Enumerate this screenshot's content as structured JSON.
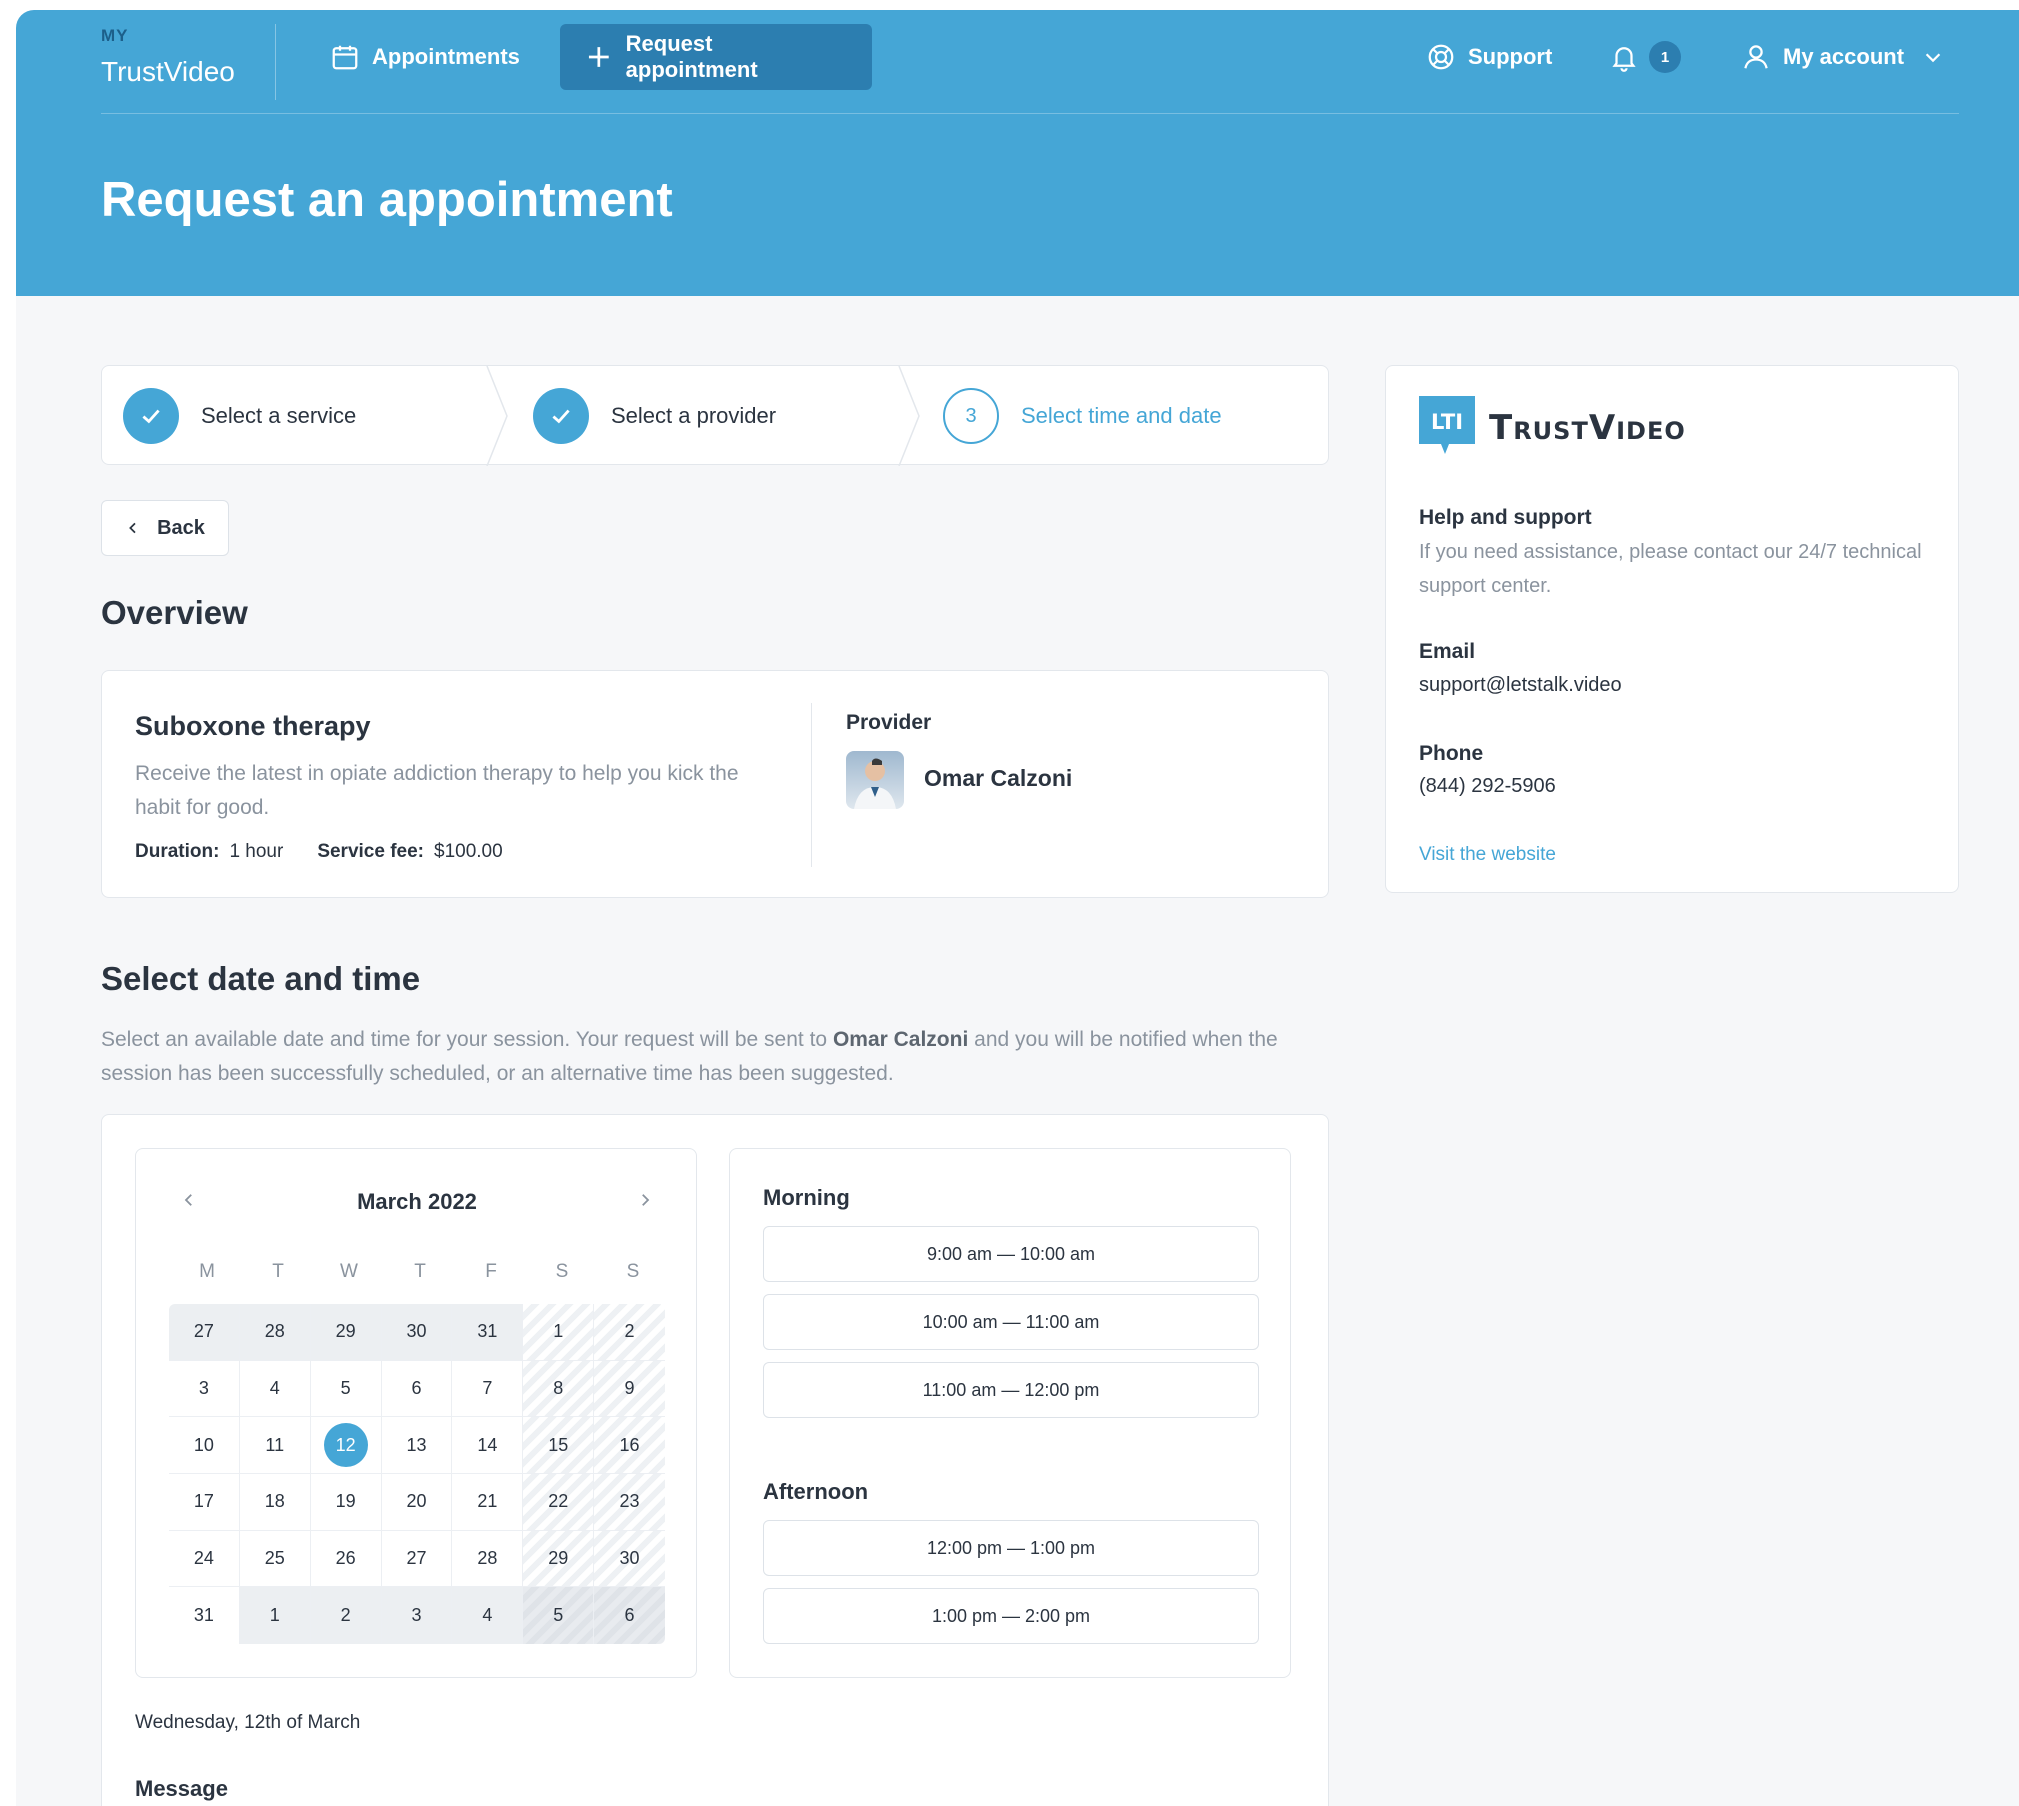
{
  "nav": {
    "brand_prefix": "MY",
    "brand_name": "TrustVideo",
    "appointments": "Appointments",
    "request_appointment": "Request appointment",
    "support": "Support",
    "notification_count": "1",
    "my_account": "My account"
  },
  "page_title": "Request an appointment",
  "steps": [
    {
      "label": "Select a service",
      "state": "done"
    },
    {
      "label": "Select a provider",
      "state": "done"
    },
    {
      "number": "3",
      "label": "Select time and date",
      "state": "current"
    }
  ],
  "back_label": "Back",
  "overview": {
    "title": "Overview",
    "service_name": "Suboxone therapy",
    "service_description": "Receive the latest in opiate addiction therapy to help you kick the habit for good.",
    "duration_label": "Duration:",
    "duration_value": "1 hour",
    "fee_label": "Service fee:",
    "fee_value": "$100.00",
    "provider_label": "Provider",
    "provider_name": "Omar Calzoni"
  },
  "select_dt": {
    "title": "Select date and time",
    "desc_before": "Select an available date and time for your session. Your request will be sent to ",
    "desc_provider": "Omar Calzoni",
    "desc_after": " and you will be notified when the session has been successfully scheduled, or an alternative time has been suggested."
  },
  "calendar": {
    "month_label": "March 2022",
    "weekdays": [
      "M",
      "T",
      "W",
      "T",
      "F",
      "S",
      "S"
    ],
    "weeks": [
      [
        "27",
        "28",
        "29",
        "30",
        "31",
        "1",
        "2"
      ],
      [
        "3",
        "4",
        "5",
        "6",
        "7",
        "8",
        "9"
      ],
      [
        "10",
        "11",
        "12",
        "13",
        "14",
        "15",
        "16"
      ],
      [
        "17",
        "18",
        "19",
        "20",
        "21",
        "22",
        "23"
      ],
      [
        "24",
        "25",
        "26",
        "27",
        "28",
        "29",
        "30"
      ],
      [
        "31",
        "1",
        "2",
        "3",
        "4",
        "5",
        "6"
      ]
    ],
    "selected_day": "12",
    "selected_date_text": "Wednesday, 12th of March"
  },
  "times": {
    "morning_label": "Morning",
    "morning_slots": [
      "9:00 am — 10:00 am",
      "10:00 am — 11:00 am",
      "11:00 am — 12:00 pm"
    ],
    "afternoon_label": "Afternoon",
    "afternoon_slots": [
      "12:00 pm — 1:00 pm",
      "1:00 pm — 2:00 pm"
    ]
  },
  "message_label": "Message",
  "sidebar": {
    "logo_mark": "LTI",
    "logo_text": "TrustVideo",
    "help_title": "Help and support",
    "help_text": "If you need assistance, please contact our 24/7 technical support center.",
    "email_label": "Email",
    "email_value": "support@letstalk.video",
    "phone_label": "Phone",
    "phone_value": "(844) 292-5906",
    "website_link": "Visit the website"
  },
  "colors": {
    "brand_blue": "#45a6d6",
    "nav_active": "#2c7eb0",
    "muted_text": "#8a939e"
  }
}
